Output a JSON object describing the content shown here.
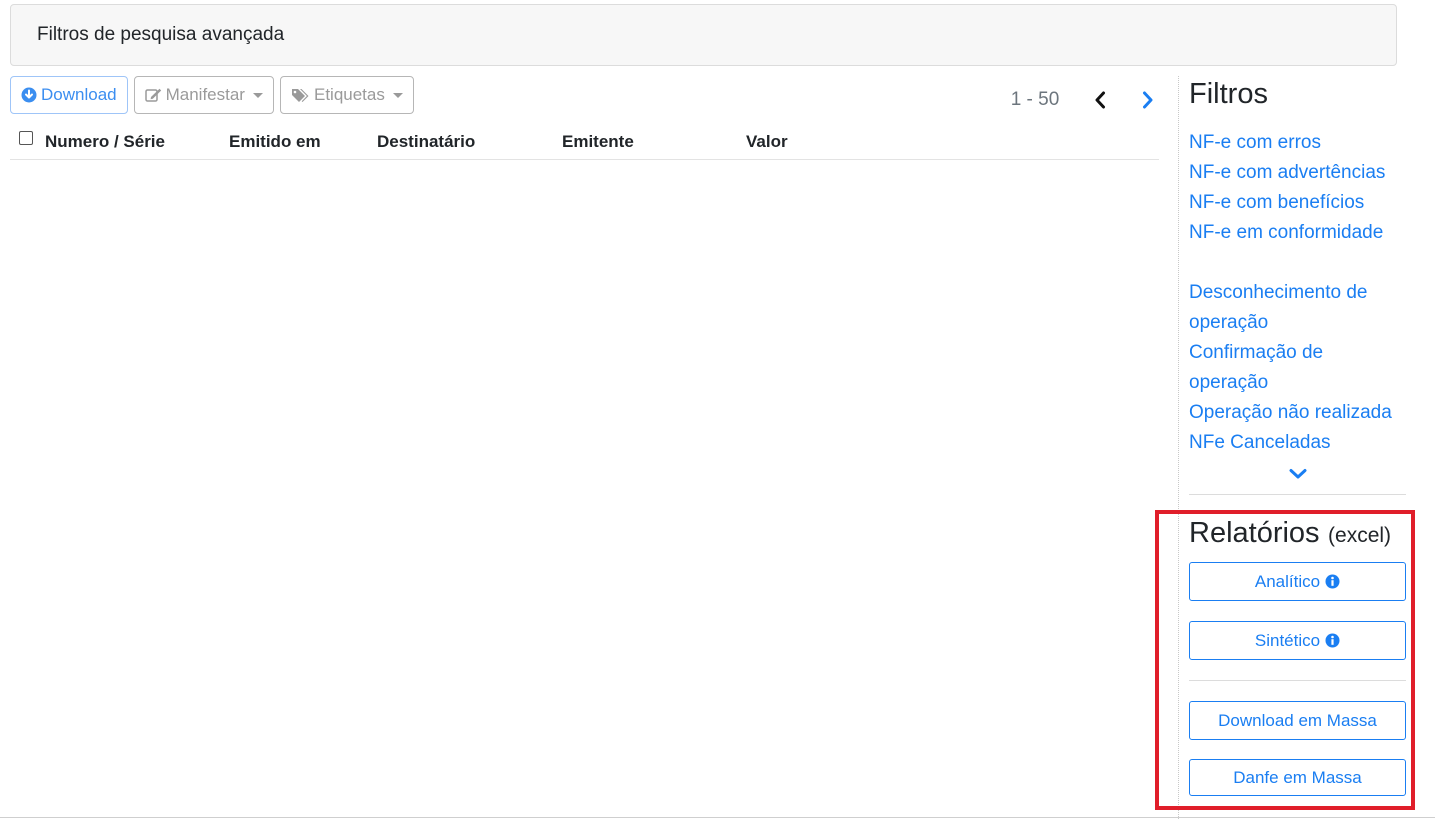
{
  "filter_bar": {
    "label": "Filtros de pesquisa avançada"
  },
  "toolbar": {
    "download_label": "Download",
    "manifestar_label": "Manifestar",
    "etiquetas_label": "Etiquetas"
  },
  "pagination": {
    "range": "1 - 50"
  },
  "table": {
    "columns": [
      "Numero / Série",
      "Emitido em",
      "Destinatário",
      "Emitente",
      "Valor"
    ]
  },
  "sidebar": {
    "filters_title": "Filtros",
    "group1": [
      "NF-e com erros",
      "NF-e com advertências",
      "NF-e com benefícios",
      "NF-e em conformidade"
    ],
    "group2": [
      "Desconhecimento de operação",
      "Confirmação de operação",
      "Operação não realizada",
      "NFe Canceladas"
    ],
    "reports_title": "Relatórios",
    "reports_subtitle": "(excel)",
    "reports": {
      "analitico": "Analítico",
      "sintetico": "Sintético",
      "download_massa": "Download em Massa",
      "danfe_massa": "Danfe em Massa"
    }
  },
  "colors": {
    "link_blue": "#1a7ef2",
    "highlight_red": "#e01e2a",
    "primary_button": "#3b8ef0"
  }
}
